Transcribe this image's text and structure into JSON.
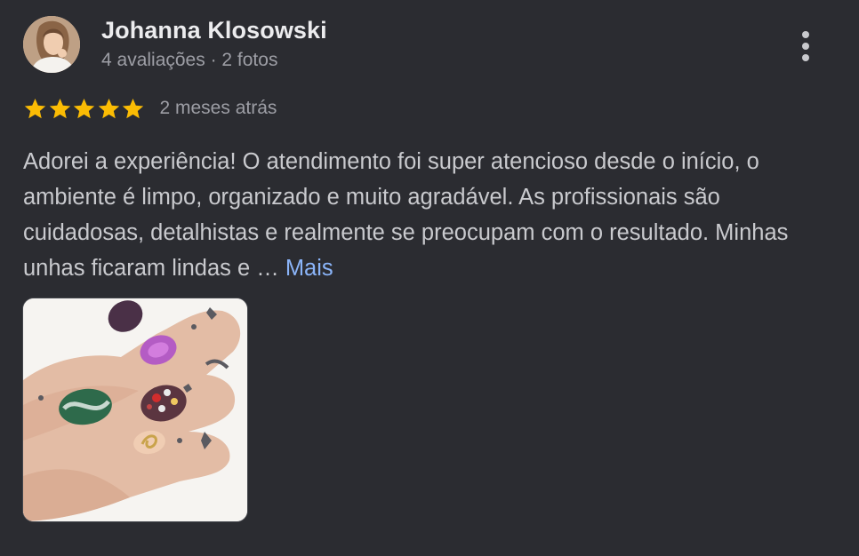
{
  "reviewer": {
    "name": "Johanna Klosowski",
    "meta": "4 avaliações · 2 fotos"
  },
  "rating": {
    "stars": 5,
    "max": 5,
    "date": "2 meses atrás",
    "star_color": "#fbbc04"
  },
  "review": {
    "text": "Adorei a experiência! O atendimento foi super atencioso desde o início, o ambiente é limpo, organizado e muito agradável. As profissionais são cuidadosas, detalhistas e realmente se preocupam com o resultado. Minhas unhas ficaram lindas e … ",
    "more_label": "Mais",
    "link_color": "#8ab4f8"
  },
  "icons": {
    "avatar": "avatar",
    "more": "more-vert-icon",
    "star": "star-icon"
  }
}
